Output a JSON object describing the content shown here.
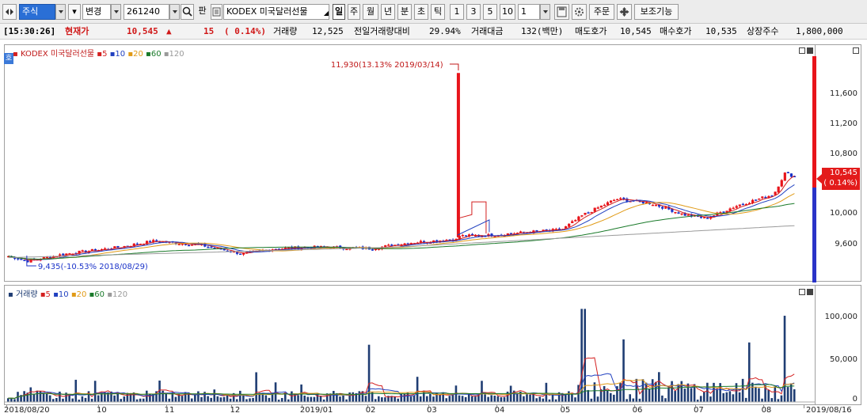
{
  "toolbar": {
    "market": "주식",
    "change_label": "변경",
    "code": "261240",
    "pan_label": "판",
    "name": "KODEX 미국달러선물",
    "periods": [
      "일",
      "주",
      "월",
      "년",
      "분",
      "초",
      "틱"
    ],
    "active_period": "일",
    "numbers": [
      "1",
      "3",
      "5",
      "10"
    ],
    "count_value": "1",
    "order_label": "주문",
    "aux_label": "보조기능"
  },
  "status": {
    "time": "[15:30:26]",
    "price_label": "현재가",
    "price": "10,545",
    "arrow": "▲",
    "change": "15",
    "change_pct": "( 0.14%)",
    "volume_label": "거래량",
    "volume": "12,525",
    "prev_ratio_label": "전일거래량대비",
    "prev_ratio": "29.94%",
    "amount_label": "거래대금",
    "amount": "132(백만)",
    "ask_label": "매도호가",
    "ask": "10,545",
    "bid_label": "매수호가",
    "bid": "10,535",
    "shares_label": "상장주수",
    "shares": "1,800,000"
  },
  "price_chart": {
    "legend_title": "KODEX 미국달러선물",
    "ma_labels": [
      "5",
      "10",
      "20",
      "60",
      "120"
    ],
    "y_ticks": [
      "11,600",
      "11,200",
      "10,800",
      "10,000",
      "9,600"
    ],
    "current_value": "10,545",
    "current_pct": "( 0.14%)",
    "max_annotation": "11,930(13.13% 2019/03/14)",
    "min_annotation": "9,435(-10.53% 2018/08/29)",
    "ylim": [
      9150,
      12300
    ]
  },
  "volume_chart": {
    "legend_title": "거래량",
    "ma_labels": [
      "5",
      "10",
      "20",
      "60",
      "120"
    ],
    "y_ticks": [
      "100,000",
      "50,000",
      "0"
    ],
    "ylim": [
      0,
      140000
    ]
  },
  "x_labels": [
    "2018/08/20",
    "10",
    "11",
    "12",
    "2019/01",
    "02",
    "03",
    "04",
    "05",
    "06",
    "07",
    "08",
    "2019/08/16"
  ],
  "colors": {
    "up": "#e8141b",
    "down": "#1b33c9",
    "ma5": "#d42020",
    "ma10": "#2040c0",
    "ma20": "#e09a16",
    "ma60": "#1a7a2a",
    "ma120": "#9a9a9a",
    "volume_bar": "#1f3d73"
  },
  "chart_data": [
    {
      "type": "candlestick",
      "title": "KODEX 미국달러선물",
      "x_range": [
        "2018/08/20",
        "2019/08/16"
      ],
      "ylim": [
        9150,
        12300
      ],
      "series": [
        {
          "name": "5",
          "type": "line"
        },
        {
          "name": "10",
          "type": "line"
        },
        {
          "name": "20",
          "type": "line"
        },
        {
          "name": "60",
          "type": "line"
        },
        {
          "name": "120",
          "type": "line"
        }
      ],
      "close_path": [
        {
          "x": "2018/08/20",
          "y": 9500
        },
        {
          "x": "2018/08/29",
          "y": 9435
        },
        {
          "x": "2018/09/15",
          "y": 9530
        },
        {
          "x": "2018/10/10",
          "y": 9620
        },
        {
          "x": "2018/10/25",
          "y": 9700
        },
        {
          "x": "2018/11/15",
          "y": 9650
        },
        {
          "x": "2018/12/05",
          "y": 9530
        },
        {
          "x": "2018/12/20",
          "y": 9600
        },
        {
          "x": "2019/01/10",
          "y": 9620
        },
        {
          "x": "2019/02/01",
          "y": 9600
        },
        {
          "x": "2019/02/20",
          "y": 9680
        },
        {
          "x": "2019/03/10",
          "y": 9720
        },
        {
          "x": "2019/03/14",
          "y": 11930
        },
        {
          "x": "2019/03/25",
          "y": 9770
        },
        {
          "x": "2019/04/15",
          "y": 9820
        },
        {
          "x": "2019/04/30",
          "y": 9850
        },
        {
          "x": "2019/05/10",
          "y": 10050
        },
        {
          "x": "2019/05/25",
          "y": 10260
        },
        {
          "x": "2019/06/10",
          "y": 10200
        },
        {
          "x": "2019/06/25",
          "y": 10050
        },
        {
          "x": "2019/07/05",
          "y": 10000
        },
        {
          "x": "2019/07/20",
          "y": 10180
        },
        {
          "x": "2019/08/05",
          "y": 10320
        },
        {
          "x": "2019/08/10",
          "y": 10600
        },
        {
          "x": "2019/08/16",
          "y": 10545
        }
      ]
    },
    {
      "type": "bar",
      "title": "거래량",
      "ylim": [
        0,
        140000
      ],
      "notable": [
        {
          "x": "2019/02/01",
          "y": 75000
        },
        {
          "x": "2019/05/10",
          "y": 122000
        },
        {
          "x": "2019/05/28",
          "y": 82000
        },
        {
          "x": "2019/07/25",
          "y": 78000
        },
        {
          "x": "2019/08/10",
          "y": 113000
        }
      ]
    }
  ]
}
